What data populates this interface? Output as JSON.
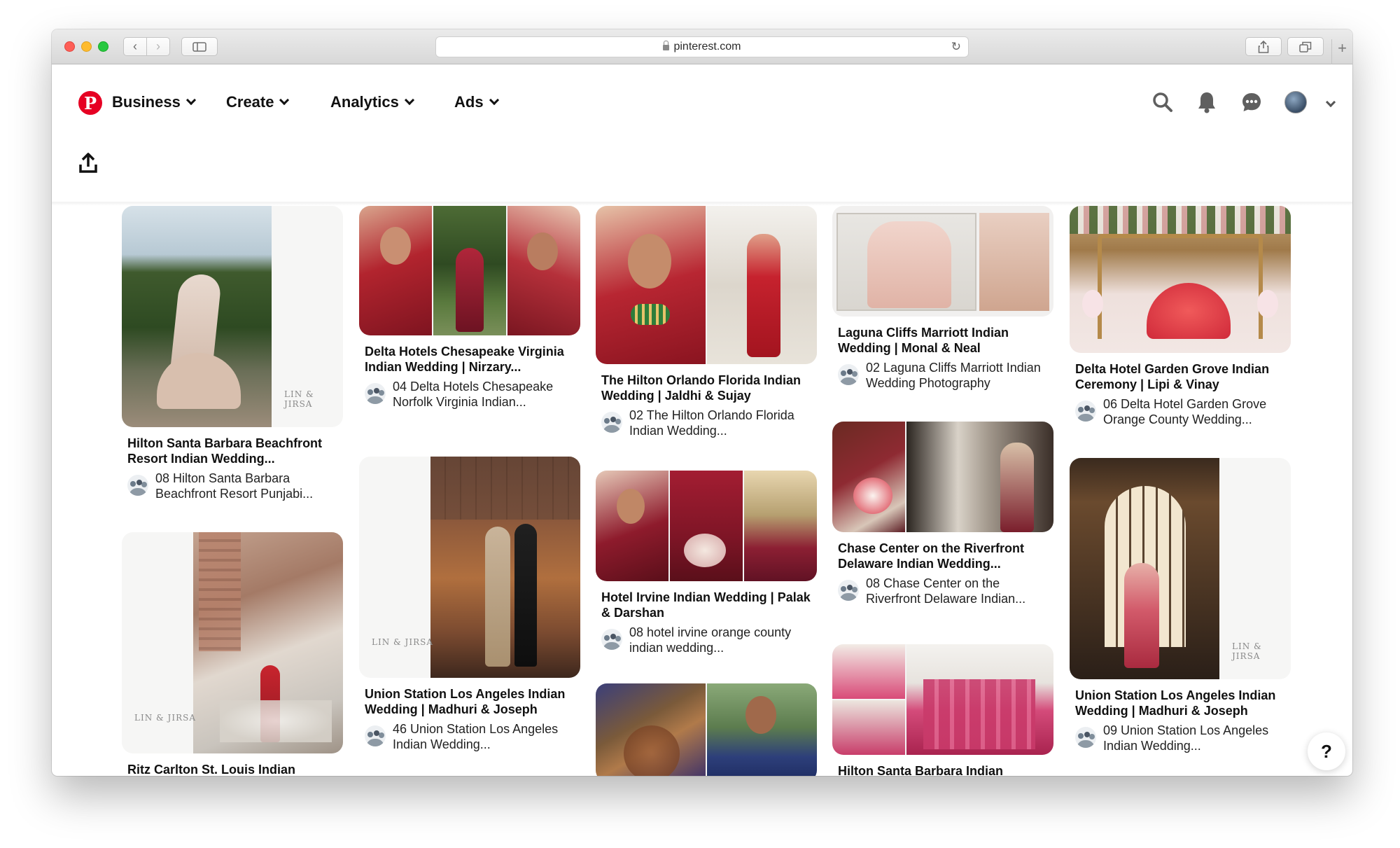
{
  "browser": {
    "url": "pinterest.com"
  },
  "nav": {
    "items": [
      {
        "label": "Business"
      },
      {
        "label": "Create"
      },
      {
        "label": "Analytics"
      },
      {
        "label": "Ads"
      }
    ]
  },
  "brand": {
    "accent": "#e60023",
    "logo_glyph": "P"
  },
  "watermark": "LIN & JIRSA",
  "help_label": "?",
  "pins": [
    {
      "title": "Hilton Santa Barbara Beachfront Resort Indian Wedding...",
      "desc": "08 Hilton Santa Barbara Beachfront Resort Punjabi..."
    },
    {
      "title": "Ritz Carlton St. Louis Indian",
      "desc": ""
    },
    {
      "title": "Delta Hotels Chesapeake Virginia Indian Wedding | Nirzary...",
      "desc": "04 Delta Hotels Chesapeake Norfolk Virginia Indian..."
    },
    {
      "title": "Union Station Los Angeles Indian Wedding | Madhuri & Joseph",
      "desc": "46 Union Station Los Angeles Indian Wedding..."
    },
    {
      "title": "The Hilton Orlando Florida Indian Wedding | Jaldhi & Sujay",
      "desc": "02 The Hilton Orlando Florida Indian Wedding..."
    },
    {
      "title": "Hotel Irvine Indian Wedding | Palak & Darshan",
      "desc": "08 hotel irvine orange county indian wedding..."
    },
    {
      "title": "",
      "desc": ""
    },
    {
      "title": "Laguna Cliffs Marriott Indian Wedding | Monal & Neal",
      "desc": "02 Laguna Cliffs Marriott Indian Wedding Photography"
    },
    {
      "title": "Chase Center on the Riverfront Delaware Indian Wedding...",
      "desc": "08 Chase Center on the Riverfront Delaware Indian..."
    },
    {
      "title": "Hilton Santa Barbara Indian",
      "desc": ""
    },
    {
      "title": "Delta Hotel Garden Grove Indian Ceremony | Lipi & Vinay",
      "desc": "06 Delta Hotel Garden Grove Orange County Wedding..."
    },
    {
      "title": "Union Station Los Angeles Indian Wedding | Madhuri & Joseph",
      "desc": "09 Union Station Los Angeles Indian Wedding..."
    }
  ]
}
